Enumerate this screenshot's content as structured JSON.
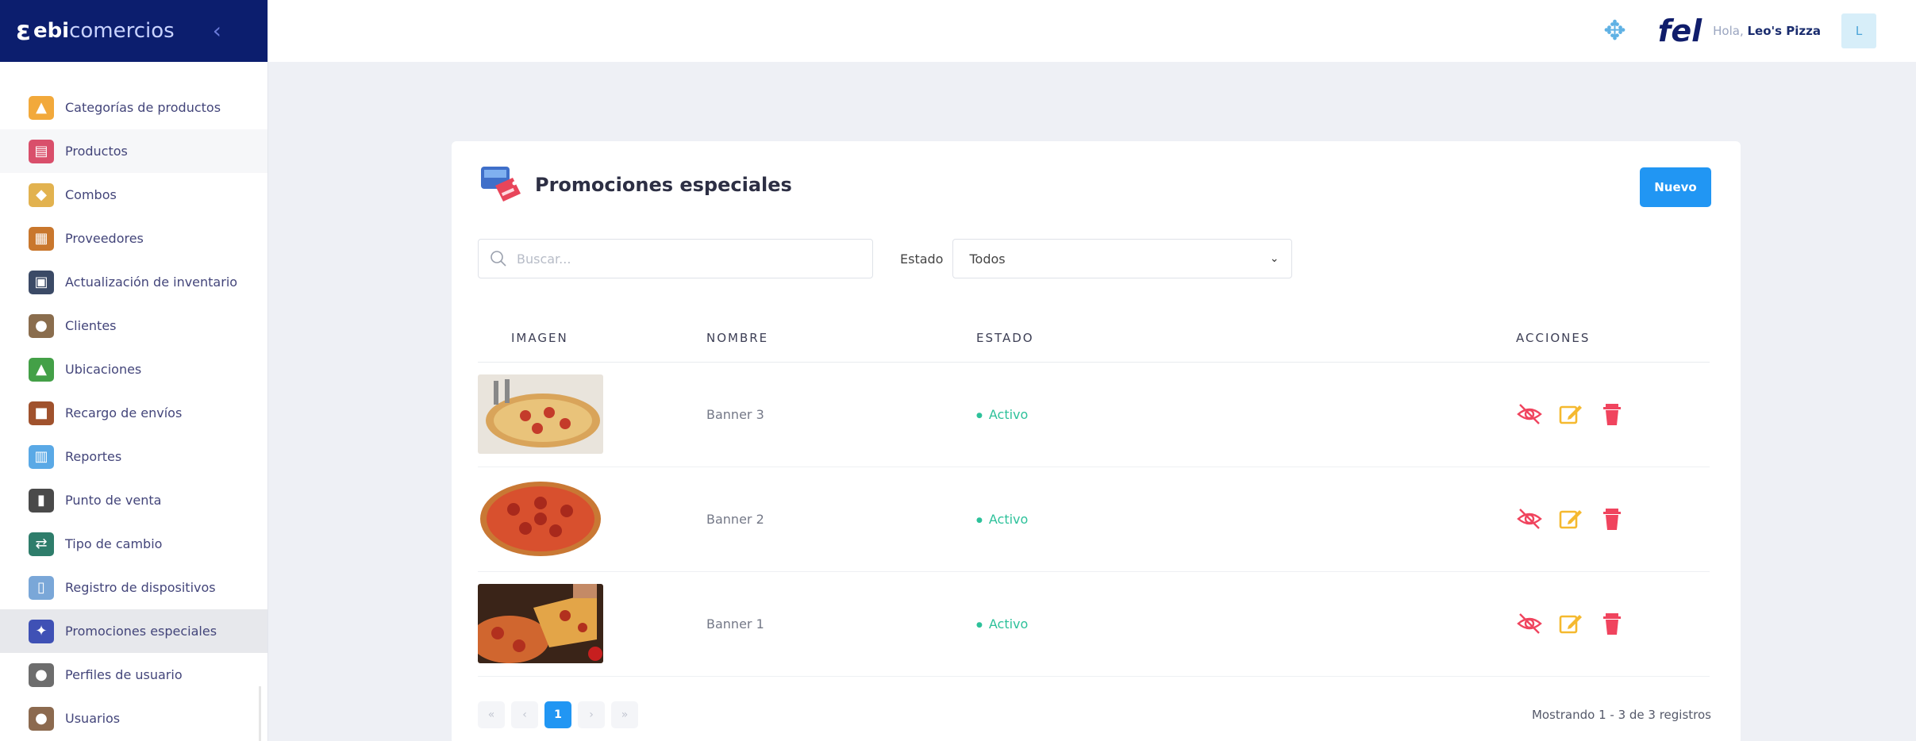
{
  "brand": {
    "logo": "ε",
    "name_bold": "ebi",
    "name_rest": "comercios",
    "collapse": "‹"
  },
  "topbar": {
    "greeting": "Hola,",
    "user": "Leo's Pizza",
    "avatar_initial": "L",
    "fel_logo": "fel"
  },
  "sidebar": {
    "items": [
      {
        "label": "Categorías de productos",
        "icon": "categories-icon",
        "color": "#f2a93b"
      },
      {
        "label": "Productos",
        "icon": "products-icon",
        "color": "#d94f6b"
      },
      {
        "label": "Combos",
        "icon": "combos-icon",
        "color": "#e2b24f"
      },
      {
        "label": "Proveedores",
        "icon": "suppliers-icon",
        "color": "#c9772d"
      },
      {
        "label": "Actualización de inventario",
        "icon": "inventory-icon",
        "color": "#3b4a66"
      },
      {
        "label": "Clientes",
        "icon": "clients-icon",
        "color": "#8a6d4d"
      },
      {
        "label": "Ubicaciones",
        "icon": "locations-icon",
        "color": "#43a047"
      },
      {
        "label": "Recargo de envíos",
        "icon": "shipping-icon",
        "color": "#a0522d"
      },
      {
        "label": "Reportes",
        "icon": "reports-icon",
        "color": "#5aa9e6"
      },
      {
        "label": "Punto de venta",
        "icon": "pos-icon",
        "color": "#4a4a4a"
      },
      {
        "label": "Tipo de cambio",
        "icon": "exchange-icon",
        "color": "#2e7d6b"
      },
      {
        "label": "Registro de dispositivos",
        "icon": "devices-icon",
        "color": "#7aa7d8"
      },
      {
        "label": "Promociones especiales",
        "icon": "promotions-icon",
        "color": "#3f51b5"
      },
      {
        "label": "Perfiles de usuario",
        "icon": "profiles-icon",
        "color": "#6d6d6d"
      },
      {
        "label": "Usuarios",
        "icon": "users-icon",
        "color": "#8c6a4f"
      }
    ]
  },
  "page": {
    "title": "Promociones especiales",
    "new_button": "Nuevo",
    "search_placeholder": "Buscar...",
    "estado_label": "Estado",
    "estado_value": "Todos"
  },
  "table": {
    "headers": [
      "IMAGEN",
      "NOMBRE",
      "ESTADO",
      "ACCIONES"
    ],
    "rows": [
      {
        "name": "Banner 3",
        "status": "Activo"
      },
      {
        "name": "Banner 2",
        "status": "Activo"
      },
      {
        "name": "Banner 1",
        "status": "Activo"
      }
    ]
  },
  "pagination": {
    "first": "«",
    "prev": "‹",
    "current": "1",
    "next": "›",
    "last": "»",
    "records": "Mostrando 1 - 3 de 3 registros"
  },
  "colors": {
    "accent": "#2196f3",
    "sidebar_brand": "#0c1e6e",
    "status_active": "#2dc19a",
    "action_danger": "#f0445e",
    "action_edit": "#f5b92f"
  }
}
